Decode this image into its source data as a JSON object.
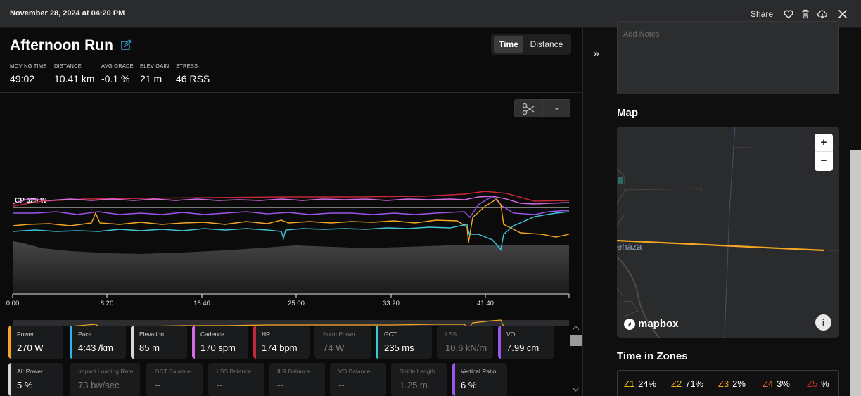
{
  "topbar": {
    "date": "November 28, 2024 at 04:20 PM",
    "share_label": "Share",
    "icons": [
      "heart-icon",
      "trash-icon",
      "cloud-download-icon",
      "close-icon"
    ]
  },
  "activity": {
    "title": "Afternoon Run",
    "toggle": {
      "time": "Time",
      "distance": "Distance",
      "selected": "Time"
    },
    "stats": [
      {
        "label": "MOVING TIME",
        "value": "49:02"
      },
      {
        "label": "DISTANCE",
        "value": "10.41 km"
      },
      {
        "label": "AVG GRADE",
        "value": "-0.1 %"
      },
      {
        "label": "ELEV GAIN",
        "value": "21 m"
      },
      {
        "label": "STRESS",
        "value": "46 RSS"
      }
    ]
  },
  "chart": {
    "cp_label": "CP 329 W",
    "x_ticks": [
      "0:00",
      "8:20",
      "16:40",
      "25:00",
      "33:20",
      "41:40"
    ]
  },
  "metrics_row1": [
    {
      "label": "Power",
      "value": "270 W",
      "color": "#f5a623",
      "active": true
    },
    {
      "label": "Pace",
      "value": "4:43 /km",
      "color": "#2bb6e8",
      "active": true
    },
    {
      "label": "Elevation",
      "value": "85 m",
      "color": "#d8d8d8",
      "active": true
    },
    {
      "label": "Cadence",
      "value": "170 spm",
      "color": "#d36ee0",
      "active": true
    },
    {
      "label": "HR",
      "value": "174 bpm",
      "color": "#c8283a",
      "active": true
    },
    {
      "label": "Form Power",
      "value": "74 W",
      "color": "",
      "active": false
    },
    {
      "label": "GCT",
      "value": "235 ms",
      "color": "#3fc6d6",
      "active": true
    },
    {
      "label": "LSS",
      "value": "10.6 kN/m",
      "color": "",
      "active": false
    },
    {
      "label": "VO",
      "value": "7.99 cm",
      "color": "#9b55ea",
      "active": true
    }
  ],
  "metrics_row2": [
    {
      "label": "Air Power",
      "value": "5 %",
      "color": "#d8d8d8",
      "active": true
    },
    {
      "label": "Impact Loading Rate",
      "value": "73 bw/sec",
      "color": "",
      "active": false
    },
    {
      "label": "GCT Balance",
      "value": "--",
      "color": "",
      "active": false
    },
    {
      "label": "LSS Balance",
      "value": "--",
      "color": "",
      "active": false
    },
    {
      "label": "ILR Balance",
      "value": "--",
      "color": "",
      "active": false
    },
    {
      "label": "VO Balance",
      "value": "--",
      "color": "",
      "active": false
    },
    {
      "label": "Stride Length",
      "value": "1.25 m",
      "color": "",
      "active": false
    },
    {
      "label": "Vertical Ratio",
      "value": "6 %",
      "color": "#9b55ea",
      "active": true
    }
  ],
  "right": {
    "notes_placeholder": "Add Notes",
    "map_title": "Map",
    "map_town": "eháza",
    "mapbox": "mapbox",
    "zoom_in": "+",
    "zoom_out": "−",
    "zones_title": "Time in Zones",
    "zones": [
      {
        "key": "Z1",
        "pct": "24%",
        "color": "#f2c40f"
      },
      {
        "key": "Z2",
        "pct": "71%",
        "color": "#f2b01e"
      },
      {
        "key": "Z3",
        "pct": "2%",
        "color": "#f29a1e"
      },
      {
        "key": "Z4",
        "pct": "3%",
        "color": "#ef6a2a"
      },
      {
        "key": "Z5",
        "pct": "%",
        "color": "#d9272d"
      }
    ]
  },
  "collapse_glyph": "»"
}
